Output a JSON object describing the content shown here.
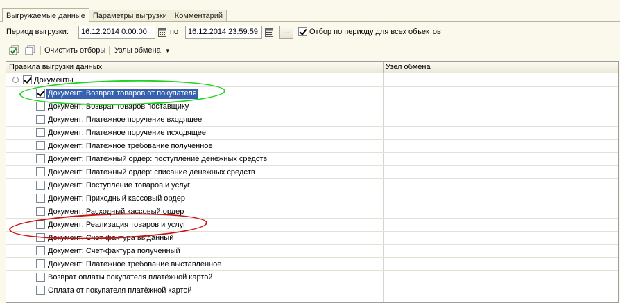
{
  "tabs": [
    {
      "label": "Выгружаемые данные",
      "active": true
    },
    {
      "label": "Параметры выгрузки",
      "active": false
    },
    {
      "label": "Комментарий",
      "active": false
    }
  ],
  "period": {
    "label": "Период выгрузки:",
    "from": "16.12.2014  0:00:00",
    "to_label": "по",
    "to": "16.12.2014 23:59:59",
    "dots": "...",
    "apply_all_label": "Отбор по периоду для всех объектов",
    "apply_all_checked": true
  },
  "toolbar": {
    "clear_filters": "Очистить отборы",
    "exchange_nodes": "Узлы обмена"
  },
  "table": {
    "columns": [
      "Правила выгрузки данных",
      "Узел обмена"
    ],
    "root": {
      "label": "Документы",
      "checked": true
    },
    "rows": [
      {
        "label": "Документ: Возврат товаров от покупателя",
        "checked": true,
        "selected": true
      },
      {
        "label": "Документ: Возврат товаров поставщику",
        "checked": false
      },
      {
        "label": "Документ: Платежное поручение входящее",
        "checked": false
      },
      {
        "label": "Документ: Платежное поручение исходящее",
        "checked": false
      },
      {
        "label": "Документ: Платежное требование полученное",
        "checked": false
      },
      {
        "label": "Документ: Платежный ордер: поступление денежных средств",
        "checked": false
      },
      {
        "label": "Документ: Платежный ордер: списание денежных средств",
        "checked": false
      },
      {
        "label": "Документ: Поступление товаров и услуг",
        "checked": false
      },
      {
        "label": "Документ: Приходный кассовый ордер",
        "checked": false
      },
      {
        "label": "Документ: Расходный кассовый ордер",
        "checked": false
      },
      {
        "label": "Документ: Реализация товаров и услуг",
        "checked": false
      },
      {
        "label": "Документ: Счет-фактура выданный",
        "checked": false
      },
      {
        "label": "Документ: Счет-фактура полученный",
        "checked": false
      },
      {
        "label": "Документ: Платежное требование выставленное",
        "checked": false
      },
      {
        "label": "Возврат оплаты покупателя платёжной картой",
        "checked": false
      },
      {
        "label": "Оплата от покупателя платёжной картой",
        "checked": false
      }
    ]
  },
  "annotations": {
    "green": "#1fd31f",
    "red": "#cc1111"
  }
}
